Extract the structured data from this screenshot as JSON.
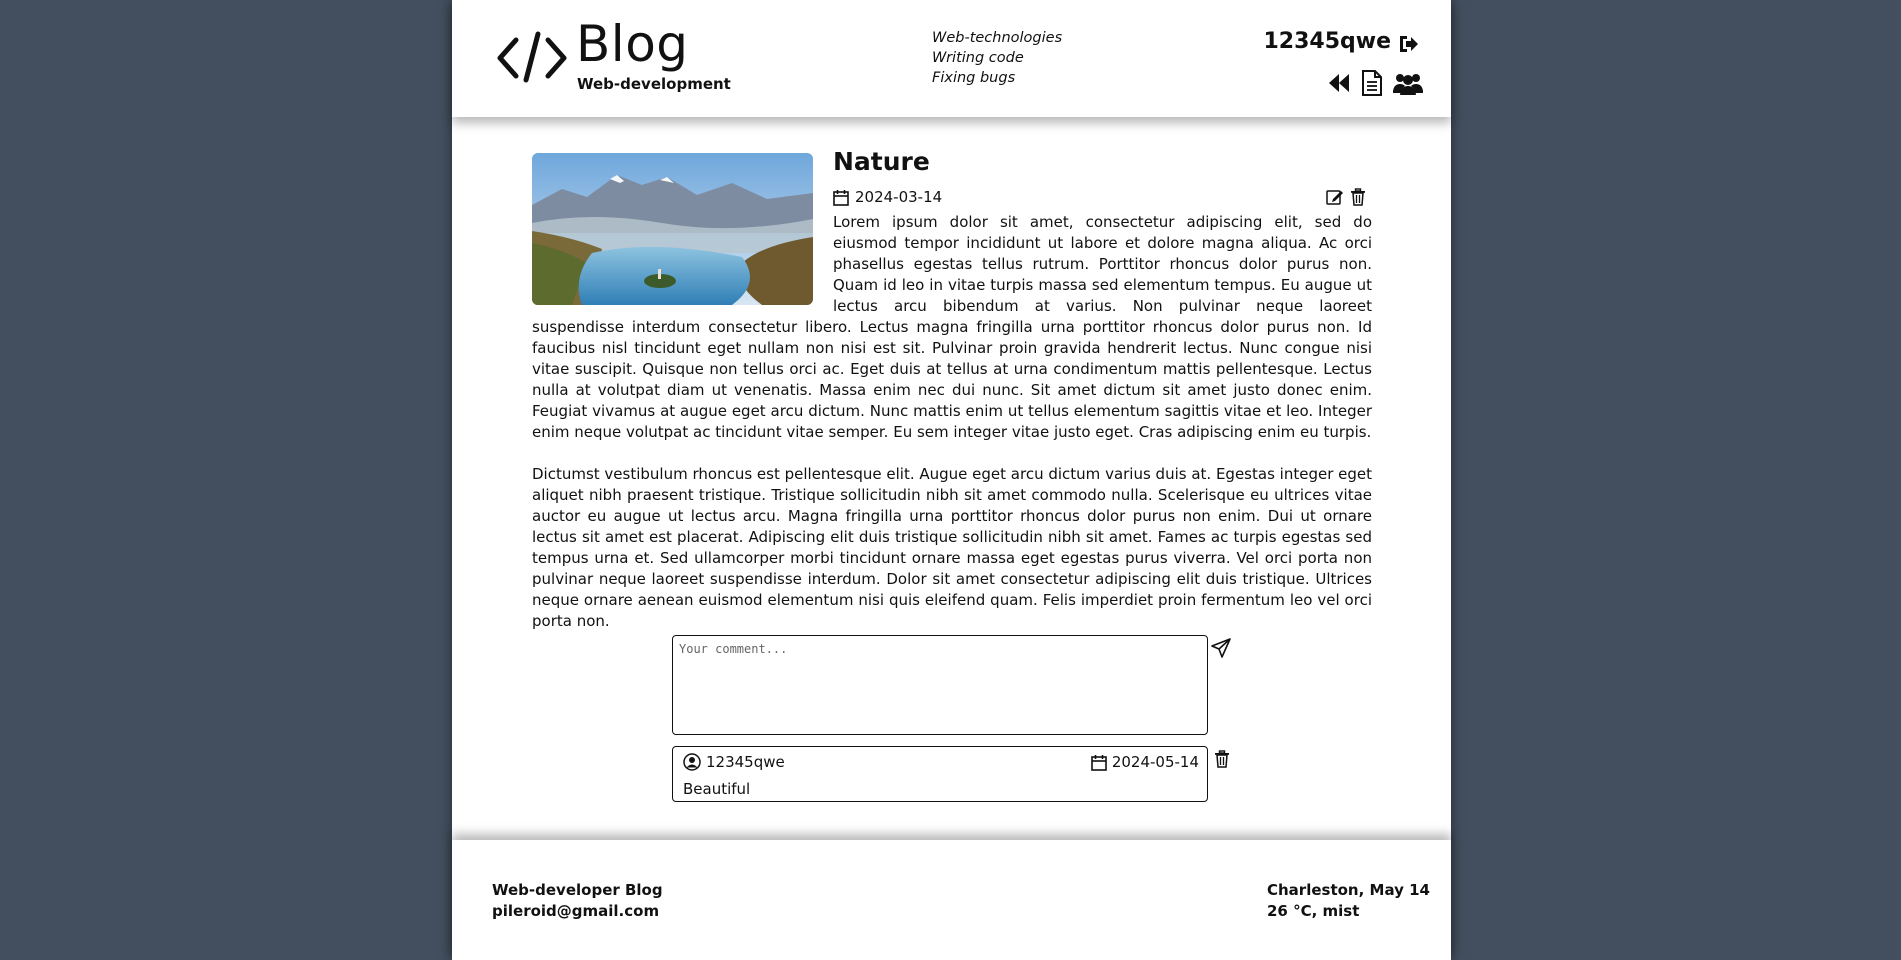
{
  "header": {
    "title": "Blog",
    "subtitle": "Web-development",
    "topics": [
      "Web-technologies",
      "Writing code",
      "Fixing bugs"
    ],
    "user": "12345qwe",
    "icons": [
      "code-icon",
      "logout-icon",
      "back-icon",
      "document-icon",
      "users-icon"
    ]
  },
  "post": {
    "title": "Nature",
    "date": "2024-03-14",
    "paragraphs": [
      "Lorem ipsum dolor sit amet, consectetur adipiscing elit, sed do eiusmod tempor incididunt ut labore et dolore magna aliqua. Ac orci phasellus egestas tellus rutrum. Porttitor rhoncus dolor purus non. Quam id leo in vitae turpis massa sed elementum tempus. Eu augue ut lectus arcu bibendum at varius. Non pulvinar neque laoreet suspendisse interdum consectetur libero. Lectus magna fringilla urna porttitor rhoncus dolor purus non. Id faucibus nisl tincidunt eget nullam non nisi est sit. Pulvinar proin gravida hendrerit lectus. Nunc congue nisi vitae suscipit. Quisque non tellus orci ac. Eget duis at tellus at urna condimentum mattis pellentesque. Lectus nulla at volutpat diam ut venenatis. Massa enim nec dui nunc. Sit amet dictum sit amet justo donec enim. Feugiat vivamus at augue eget arcu dictum. Nunc mattis enim ut tellus elementum sagittis vitae et leo. Integer enim neque volutpat ac tincidunt vitae semper. Eu sem integer vitae justo eget. Cras adipiscing enim eu turpis.",
      "Dictumst vestibulum rhoncus est pellentesque elit. Augue eget arcu dictum varius duis at. Egestas integer eget aliquet nibh praesent tristique. Tristique sollicitudin nibh sit amet commodo nulla. Scelerisque eu ultrices vitae auctor eu augue ut lectus arcu. Magna fringilla urna porttitor rhoncus dolor purus non enim. Dui ut ornare lectus sit amet est placerat. Adipiscing elit duis tristique sollicitudin nibh sit amet. Fames ac turpis egestas sed tempus urna et. Sed ullamcorper morbi tincidunt ornare massa eget egestas purus viverra. Vel orci porta non pulvinar neque laoreet suspendisse interdum. Dolor sit amet consectetur adipiscing elit duis tristique. Ultrices neque ornare aenean euismod elementum nisi quis eleifend quam. Felis imperdiet proin fermentum leo vel orci porta non."
    ],
    "image": "mountain-lake-photo"
  },
  "comment_form": {
    "placeholder": "Your comment...",
    "value": ""
  },
  "comments": [
    {
      "author": "12345qwe",
      "date": "2024-05-14",
      "text": "Beautiful"
    }
  ],
  "footer": {
    "blog_name": "Web-developer Blog",
    "email": "pileroid@gmail.com",
    "location": "Charleston, May 14",
    "weather": "26 °C, mist"
  },
  "colors": {
    "background": "#434f5e",
    "page": "#ffffff",
    "text": "#111111"
  }
}
